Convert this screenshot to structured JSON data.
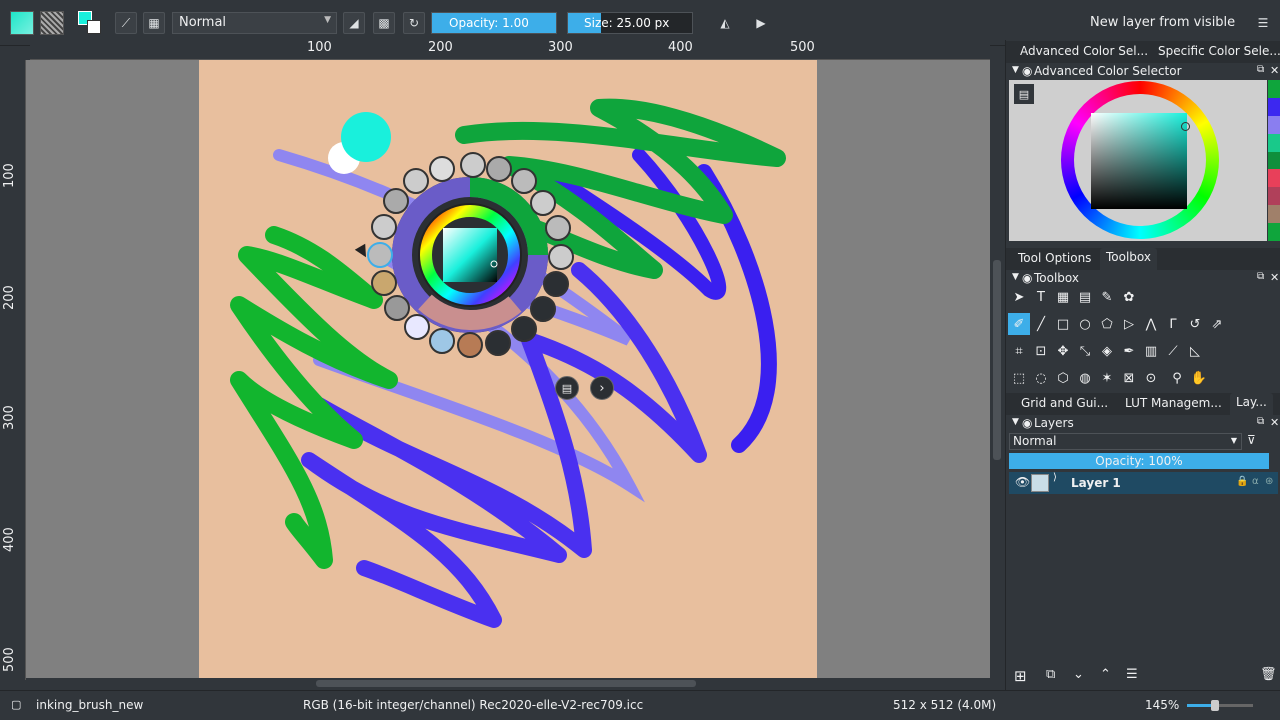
{
  "toolbar": {
    "blend_mode": "Normal",
    "opacity_label": "Opacity:  1.00",
    "opacity_value": 1.0,
    "size_label": "Size:  25.00 px",
    "size_value": 25.0,
    "new_layer_label": "New layer from visible"
  },
  "ruler": {
    "top": [
      "100",
      "200",
      "300",
      "400",
      "500"
    ],
    "left": [
      "100",
      "200",
      "300",
      "400",
      "500"
    ]
  },
  "dock": {
    "color_tabs": [
      "Advanced Color Sel...",
      "Specific Color Sele..."
    ],
    "color_panel_title": "Advanced Color Selector",
    "tool_tabs": [
      "Tool Options",
      "Toolbox"
    ],
    "toolbox_title": "Toolbox",
    "lower_tabs": [
      "Grid and Gui...",
      "LUT Managem...",
      "Lay..."
    ],
    "layers_title": "Layers",
    "layers_blend": "Normal",
    "layers_opacity": "Opacity:  100%",
    "layer_name": "Layer 1"
  },
  "status": {
    "brush": "inking_brush_new",
    "color_space": "RGB (16-bit integer/channel)  Rec2020-elle-V2-rec709.icc",
    "dimensions": "512 x 512 (4.0M)",
    "zoom": "145%"
  },
  "colors": {
    "foreground": "#19f0dc",
    "background": "#ffffff",
    "accent": "#3daee9",
    "canvas": "#e8bf9e",
    "stroke_green": "#0fa53c",
    "stroke_blue": "#3c28f0"
  }
}
